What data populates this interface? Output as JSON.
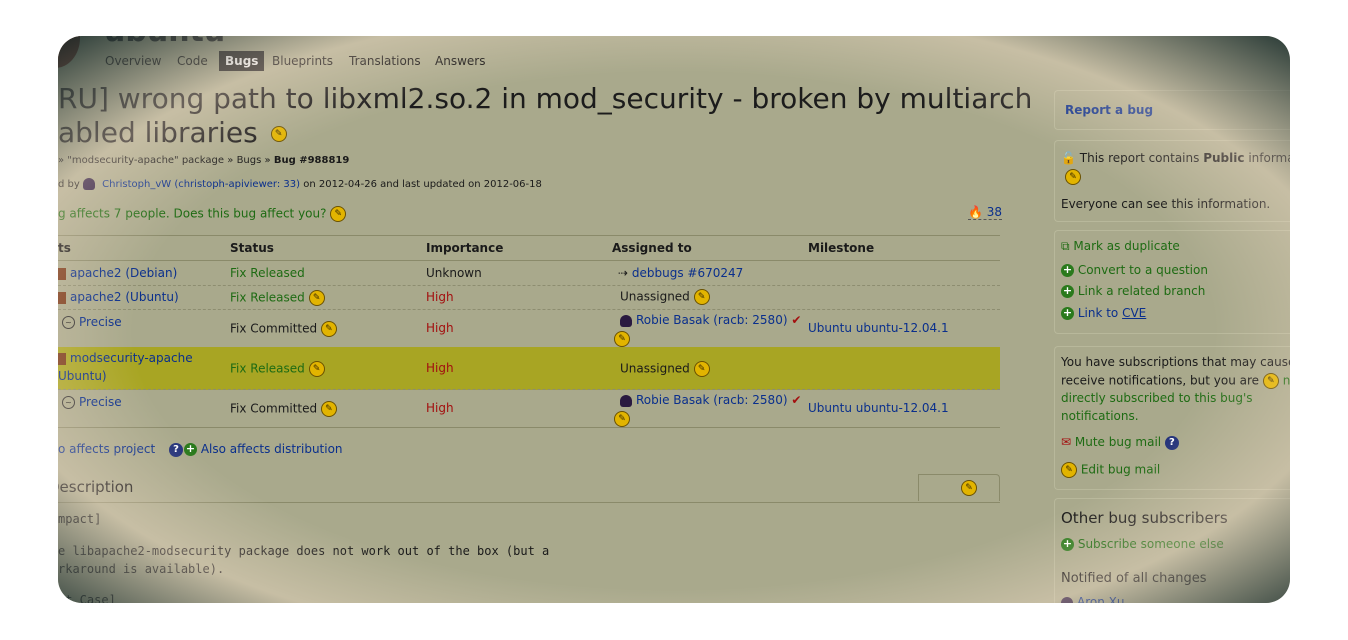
{
  "nav": {
    "tabs": [
      {
        "label": "Overview"
      },
      {
        "label": "Code"
      },
      {
        "label": "Bugs"
      },
      {
        "label": "Blueprints"
      },
      {
        "label": "Translations"
      },
      {
        "label": "Answers"
      }
    ]
  },
  "bug": {
    "title_line1": "RU] wrong path to libxml2.so.2 in mod_security - broken by multiarch",
    "title_line2": "abled libraries",
    "breadcrumb_pkg": "» \"modsecurity-apache\" package",
    "breadcrumb_sep": "»",
    "breadcrumb_bugs": "Bugs",
    "breadcrumb_id": "Bug #988819",
    "reported_prefix": "d by",
    "reporter_name": "Christoph_vW",
    "reporter_handle": "(christoph-apiviewer: 33)",
    "reported_suffix": "on 2012-04-26 and last updated on 2012-06-18",
    "affects_text": "g affects 7 people. Does this bug affect you?",
    "heat_value": "38"
  },
  "table": {
    "headers": {
      "affects": "ts",
      "status": "Status",
      "importance": "Importance",
      "assigned": "Assigned to",
      "milestone": "Milestone"
    },
    "rows": [
      {
        "affects": "apache2 (Debian)",
        "status": "Fix Released",
        "importance": "Unknown",
        "assigned": "debbugs #670247",
        "milestone": ""
      },
      {
        "affects": "apache2 (Ubuntu)",
        "status": "Fix Released",
        "importance": "High",
        "assigned": "Unassigned",
        "milestone": ""
      },
      {
        "affects": "Precise",
        "status": "Fix Committed",
        "importance": "High",
        "assigned": "Robie Basak (racb: 2580)",
        "milestone": "Ubuntu ubuntu-12.04.1"
      },
      {
        "affects_line1": "modsecurity-apache",
        "affects_line2": "Ubuntu)",
        "status": "Fix Released",
        "importance": "High",
        "assigned": "Unassigned",
        "milestone": ""
      },
      {
        "affects": "Precise",
        "status": "Fix Committed",
        "importance": "High",
        "assigned": "Robie Basak (racb: 2580)",
        "milestone": "Ubuntu ubuntu-12.04.1"
      }
    ]
  },
  "actions": {
    "also_project": "o affects project",
    "also_distribution": "Also affects distribution"
  },
  "description": {
    "heading": "Description",
    "line1": "mpact]",
    "line2": "e libapache2-modsecurity package does not work out of the box (but a",
    "line3": "rkaround is available).",
    "line4": "st Case]"
  },
  "sidebar": {
    "report_bug": "Report a bug",
    "privacy_prefix": "This report contains",
    "privacy_bold": "Public",
    "privacy_suffix": "information",
    "privacy_note": "Everyone can see this information.",
    "mark_duplicate": "Mark as duplicate",
    "convert_question": "Convert to a question",
    "link_branch": "Link a related branch",
    "link_cve_prefix": "Link to",
    "link_cve_abbr": "CVE",
    "subs_line1": "You have subscriptions that may cause you",
    "subs_line2_a": "receive notifications, but you are",
    "subs_line2_b": "not",
    "subs_line3": "directly subscribed to this bug's",
    "subs_line4": "notifications.",
    "mute": "Mute bug mail",
    "edit_mail": "Edit bug mail",
    "other_subscribers": "Other bug subscribers",
    "subscribe_else": "Subscribe someone else",
    "notified_heading": "Notified of all changes",
    "notified_first": "Aron Xu"
  }
}
